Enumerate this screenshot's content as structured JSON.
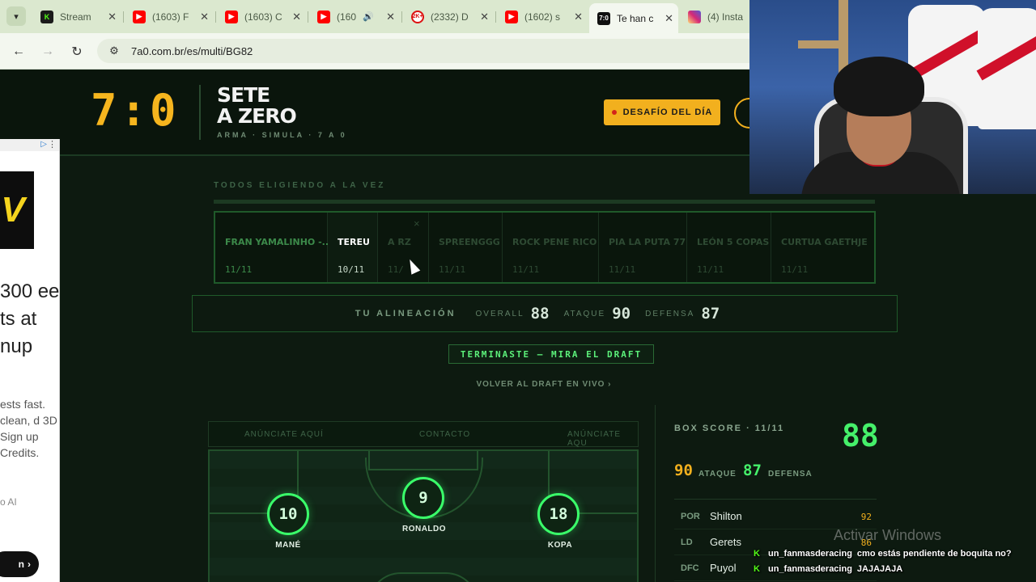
{
  "browser": {
    "tabs": [
      {
        "title": "Stream",
        "favicon": "kick-icon"
      },
      {
        "title": "(1603) F",
        "favicon": "youtube-icon"
      },
      {
        "title": "(1603) C",
        "favicon": "youtube-icon"
      },
      {
        "title": "(160",
        "favicon": "youtube-icon",
        "audio": "speaker-icon"
      },
      {
        "title": "(2332) D",
        "favicon": "2k-icon"
      },
      {
        "title": "(1602) s",
        "favicon": "youtube-icon"
      },
      {
        "title": "Te han c",
        "favicon": "7a0-icon",
        "active": true
      },
      {
        "title": "(4) Insta",
        "favicon": "instagram-icon"
      }
    ],
    "favicon_text": {
      "kick": "K",
      "seven": "7:0",
      "twok": "2K+"
    },
    "url": "7a0.com.br/es/multi/BG82",
    "glyphs": {
      "dropdown": "▾",
      "close": "✕",
      "speaker": "🔊",
      "back": "←",
      "forward": "→",
      "reload": "↻",
      "site_info": "⚙",
      "pointer": "›",
      "ad_choice": "▷",
      "ad_close": "⋮"
    }
  },
  "header": {
    "score": "7:0",
    "title_line1": "SETE",
    "title_line2": "A ZERO",
    "subtitle": "ARMA · SIMULA · 7 A 0",
    "challenge_label": "DESAFÍO DEL DÍA"
  },
  "ad": {
    "logo_letter": "V",
    "headline": "300 ee ts at nup",
    "body": "ests fast. clean, d 3D Sign up Credits.",
    "brand": "o AI",
    "cta": "n"
  },
  "draft": {
    "section_label": "TODOS ELIGIENDO A LA VEZ",
    "close_glyph": "×",
    "players": [
      {
        "name": "FRAN YAMALINHO -...",
        "count": "11/11"
      },
      {
        "name": "TEREU",
        "count": "10/11"
      },
      {
        "name": "A RZ",
        "count": "11/"
      },
      {
        "name": "SPREENGGG",
        "count": "11/11"
      },
      {
        "name": "ROCK PENE RICO",
        "count": "11/11"
      },
      {
        "name": "PIA LA PUTA 77",
        "count": "11/11"
      },
      {
        "name": "LEÓN 5 COPAS",
        "count": "11/11"
      },
      {
        "name": "CURTUA GAETHJE",
        "count": "11/11"
      }
    ]
  },
  "lineup": {
    "title": "TU ALINEACIÓN",
    "overall_label": "OVERALL",
    "overall": "88",
    "attack_label": "ATAQUE",
    "attack": "90",
    "defense_label": "DEFENSA",
    "defense": "87"
  },
  "finished_label": "TERMINASTE — MIRA EL DRAFT",
  "back_link": "VOLVER AL DRAFT EN VIVO ›",
  "ads_row": {
    "left": "ANÚNCIATE AQUÍ",
    "center": "CONTACTO",
    "right": "ANÚNCIATE AQU"
  },
  "pitch_players": [
    {
      "number": "10",
      "name": "MANÉ"
    },
    {
      "number": "9",
      "name": "RONALDO"
    },
    {
      "number": "18",
      "name": "KOPA"
    }
  ],
  "box_score": {
    "title": "BOX SCORE · 11/11",
    "overall": "88",
    "attack": "90",
    "attack_label": "ATAQUE",
    "defense": "87",
    "defense_label": "DEFENSA",
    "roster": [
      {
        "pos": "POR",
        "name": "Shilton",
        "value": "92"
      },
      {
        "pos": "LD",
        "name": "Gerets",
        "value": "86"
      },
      {
        "pos": "DFC",
        "name": "Puyol",
        "value": ""
      }
    ]
  },
  "watermark": "Activar Windows",
  "chat": {
    "badge": "K",
    "messages": [
      {
        "user": "un_fanmasderacing",
        "text": "cmo estás pendiente de boquita no?"
      },
      {
        "user": "un_fanmasderacing",
        "text": "JAJAJAJA"
      }
    ]
  },
  "colors": {
    "accent_gold": "#f2b01e",
    "accent_green": "#45f06a",
    "background": "#0d1a10"
  }
}
